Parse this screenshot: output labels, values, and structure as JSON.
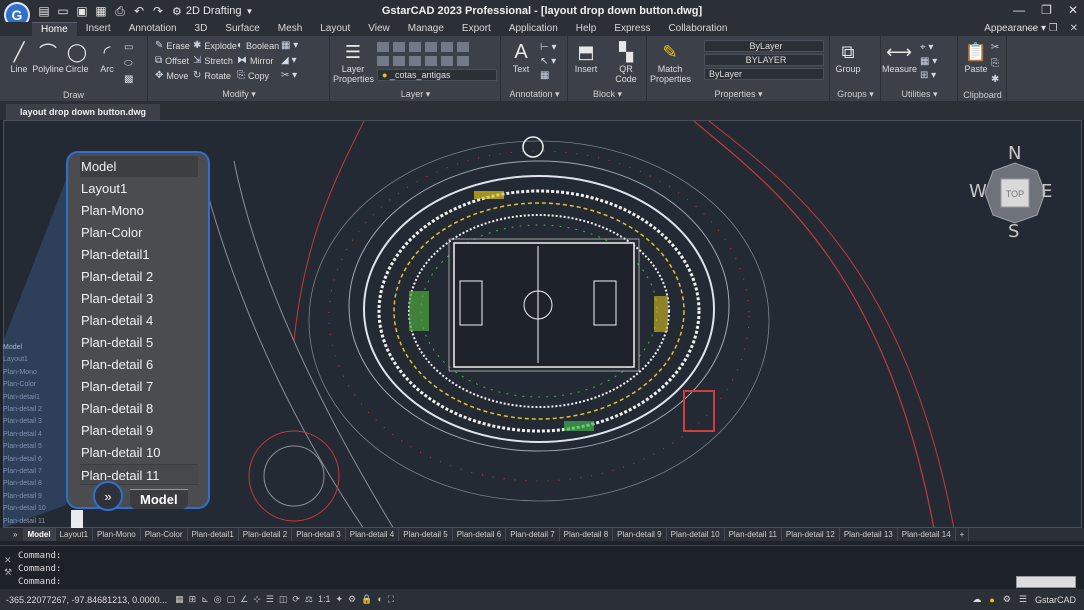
{
  "app": {
    "logo_letter": "G",
    "workspace": "2D Drafting",
    "title": "GstarCAD 2023 Professional - [layout drop down button.dwg]",
    "brand_status": "GstarCAD"
  },
  "menu": {
    "tabs": [
      "Home",
      "Insert",
      "Annotation",
      "3D",
      "Surface",
      "Mesh",
      "Layout",
      "View",
      "Manage",
      "Export",
      "Application",
      "Help",
      "Express",
      "Collaboration"
    ],
    "active": "Home",
    "appearance": "Appearance"
  },
  "ribbon": {
    "draw": {
      "title": "Draw",
      "tools": [
        "Line",
        "Polyline",
        "Circle",
        "Arc"
      ]
    },
    "modify": {
      "title": "Modify",
      "tools": [
        "Erase",
        "Explode",
        "Boolean",
        "Offset",
        "Stretch",
        "Mirror",
        "Move",
        "Rotate",
        "Copy"
      ]
    },
    "layer": {
      "title": "Layer",
      "big": "Layer Properties",
      "current": "_cotas_antigas"
    },
    "annotation": {
      "title": "Annotation",
      "big": "Text"
    },
    "block": {
      "title": "Block",
      "tools": [
        "Insert",
        "QR Code"
      ]
    },
    "properties": {
      "title": "Properties",
      "big": "Match Properties",
      "fields": [
        "ByLayer",
        "BYLAYER",
        "ByLayer"
      ]
    },
    "groups": {
      "title": "Groups",
      "big": "Group"
    },
    "utilities": {
      "title": "Utilities",
      "big": "Measure"
    },
    "clipboard": {
      "title": "Clipboard",
      "big": "Paste"
    }
  },
  "document_tab": "layout drop down button.dwg",
  "viewcube": {
    "n": "N",
    "s": "S",
    "e": "E",
    "w": "W",
    "face": "TOP"
  },
  "left_layout_list": [
    "Model",
    "Layout1",
    "Plan-Mono",
    "Plan-Color",
    "Plan-detail1",
    "Plan-detail 2",
    "Plan-detail 3",
    "Plan-detail 4",
    "Plan-detail 5",
    "Plan-detail 6",
    "Plan-detail 7",
    "Plan-detail 8",
    "Plan-detail 9",
    "Plan-detail 10",
    "Plan-detail 11"
  ],
  "popup": {
    "items": [
      "Model",
      "Layout1",
      "Plan-Mono",
      "Plan-Color",
      "Plan-detail1",
      "Plan-detail 2",
      "Plan-detail 3",
      "Plan-detail 4",
      "Plan-detail 5",
      "Plan-detail 6",
      "Plan-detail 7",
      "Plan-detail 8",
      "Plan-detail 9",
      "Plan-detail 10",
      "Plan-detail 11"
    ],
    "chevron": "»",
    "model_button": "Model"
  },
  "layout_tabs": [
    "Model",
    "Layout1",
    "Plan-Mono",
    "Plan-Color",
    "Plan-detail1",
    "Plan-detail 2",
    "Plan-detail 3",
    "Plan-detail 4",
    "Plan-detail 5",
    "Plan-detail 6",
    "Plan-detail 7",
    "Plan-detail 8",
    "Plan-detail 9",
    "Plan-detail 10",
    "Plan-detail 11",
    "Plan-detail 12",
    "Plan-detail 13",
    "Plan-detail 14",
    "+"
  ],
  "command": {
    "lines": [
      "Command:",
      "Command:",
      "Command:"
    ]
  },
  "status": {
    "coords": "-365.22077267, -97.84681213, 0.0000...",
    "scale": "1:1"
  },
  "colors": {
    "accent": "#2f6fd0",
    "canvas": "#242a33",
    "ribbon": "#3b4049"
  }
}
